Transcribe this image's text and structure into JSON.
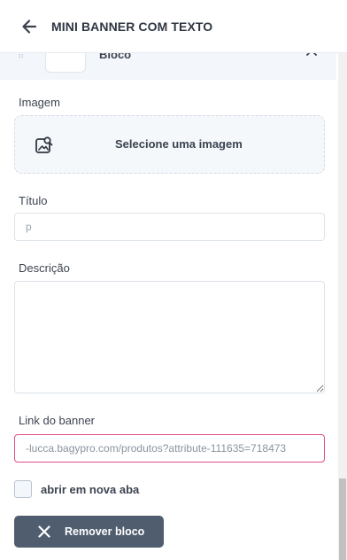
{
  "header": {
    "title": "MINI BANNER COM TEXTO",
    "back_icon": "arrow-left-icon"
  },
  "block": {
    "label": "Bloco",
    "drag_icon": "drag-handle-icon",
    "toggle_icon": "chevron-up-icon"
  },
  "form": {
    "image": {
      "label": "Imagem",
      "picker_text": "Selecione uma imagem",
      "icon": "image-search-icon"
    },
    "title": {
      "label": "Título",
      "placeholder": "p",
      "value": ""
    },
    "description": {
      "label": "Descrição",
      "value": ""
    },
    "link": {
      "label": "Link do banner",
      "value": "-lucca.bagypro.com/produtos?attribute-111635=718473"
    },
    "new_tab": {
      "label": "abrir em nova aba",
      "checked": false
    }
  },
  "actions": {
    "remove_label": "Remover bloco",
    "remove_icon": "close-icon"
  },
  "colors": {
    "accent_focus": "#e04f8a",
    "button_bg": "#505d6e",
    "panel_bg": "#f5f8fb"
  }
}
